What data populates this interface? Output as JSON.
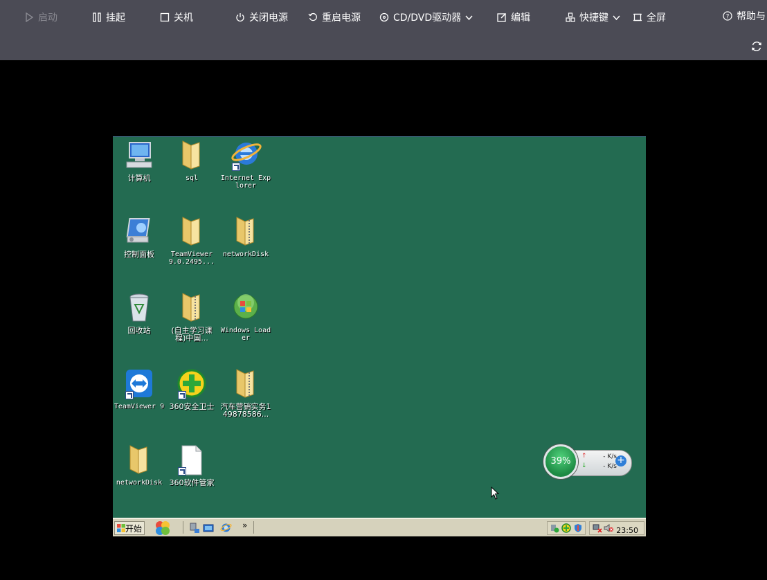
{
  "toolbar": {
    "start": "启动",
    "suspend": "挂起",
    "shutdown": "关机",
    "power_off": "关闭电源",
    "restart_power": "重启电源",
    "cd_dvd": "CD/DVD驱动器",
    "edit": "编辑",
    "shortcuts": "快捷键",
    "fullscreen": "全屏",
    "help": "帮助与"
  },
  "desktop": {
    "icons": [
      {
        "label": "计算机"
      },
      {
        "label": "sql"
      },
      {
        "label": "Internet Explorer"
      },
      {
        "label": "控制面板"
      },
      {
        "label": "TeamViewer 9.0.2495..."
      },
      {
        "label": "networkDisk"
      },
      {
        "label": "回收站"
      },
      {
        "label": "(自主学习课程)中国..."
      },
      {
        "label": "Windows Loader"
      },
      {
        "label": "TeamViewer 9"
      },
      {
        "label": "360安全卫士"
      },
      {
        "label": "汽车营销实务149878586..."
      },
      {
        "label": "networkDisk"
      },
      {
        "label": "360软件管家"
      }
    ]
  },
  "widget": {
    "percent": "39%",
    "up_speed": "- K/s",
    "down_speed": "- K/s"
  },
  "taskbar": {
    "start_label": "开始",
    "overflow": "»",
    "clock": "23:50"
  },
  "colors": {
    "toolbar_bg": "#4b4b55",
    "desktop_bg": "#236b51",
    "taskbar_bg": "#d6d2bc"
  }
}
